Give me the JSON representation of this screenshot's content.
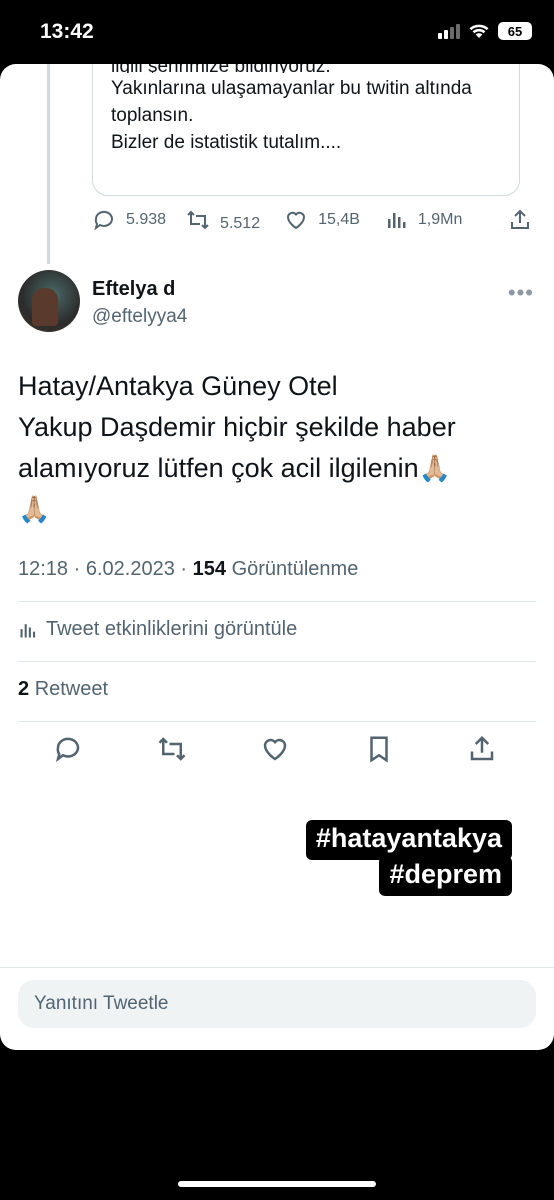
{
  "status_bar": {
    "time": "13:42",
    "battery": "65"
  },
  "quoted_tweet": {
    "lines_cut": "ilgili şehrimize bildiriyoruz.",
    "lines": [
      "Yakınlarına ulaşamayanlar bu twitin altında",
      "toplansın.",
      "Bizler de istatistik tutalım...."
    ]
  },
  "quoted_actions": {
    "replies": "5.938",
    "retweets": "5.512",
    "likes": "15,4B",
    "views": "1,9Mn"
  },
  "author": {
    "name": "Eftelya d",
    "handle": "@eftelyya4"
  },
  "tweet": {
    "lines": [
      "Hatay/Antakya Güney Otel",
      "Yakup Daşdemir hiçbir şekilde haber",
      "alamıyoruz lütfen çok acil ilgilenin"
    ],
    "emoji": "🙏🏼"
  },
  "meta": {
    "time": "12:18",
    "sep": "·",
    "date": "6.02.2023",
    "views_count": "154",
    "views_label": "Görüntülenme"
  },
  "activity_link": "Tweet etkinliklerini görüntüle",
  "retweet_count": "2",
  "retweet_label": "Retweet",
  "hashtags": [
    "#hatayantakya",
    "#deprem"
  ],
  "reply_placeholder": "Yanıtını Tweetle",
  "icons": [
    "reply-icon",
    "retweet-icon",
    "like-icon",
    "bookmark-icon",
    "share-icon",
    "analytics-icon"
  ]
}
